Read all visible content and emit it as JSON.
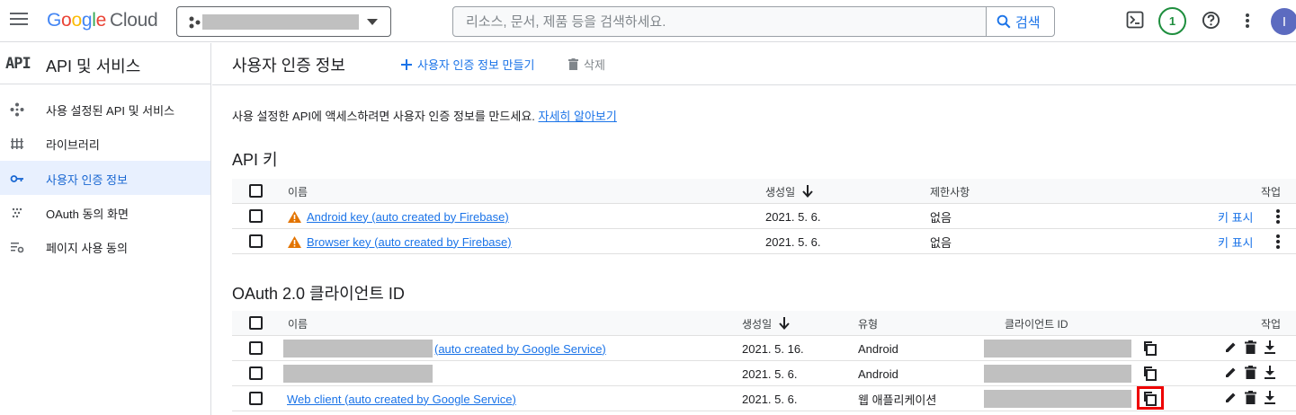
{
  "header": {
    "logo_google": "Google",
    "logo_cloud": "Cloud",
    "search_placeholder": "리소스, 문서, 제품 등을 검색하세요.",
    "search_button": "검색",
    "notification_count": "1",
    "avatar_initial": "I"
  },
  "sidebar": {
    "logo": "API",
    "title": "API 및 서비스",
    "items": [
      {
        "label": "사용 설정된 API 및 서비스",
        "icon": "api-diamond-icon"
      },
      {
        "label": "라이브러리",
        "icon": "library-icon"
      },
      {
        "label": "사용자 인증 정보",
        "icon": "key-icon",
        "active": true
      },
      {
        "label": "OAuth 동의 화면",
        "icon": "oauth-dots-icon"
      },
      {
        "label": "페이지 사용 동의",
        "icon": "settings-list-icon"
      }
    ]
  },
  "main": {
    "title": "사용자 인증 정보",
    "create_label": "사용자 인증 정보 만들기",
    "delete_label": "삭제",
    "intro_text": "사용 설정한 API에 액세스하려면 사용자 인증 정보를 만드세요.",
    "intro_link": "자세히 알아보기"
  },
  "api_keys": {
    "section_title": "API 키",
    "columns": {
      "name": "이름",
      "created": "생성일",
      "restrictions": "제한사항",
      "actions": "작업"
    },
    "rows": [
      {
        "name": "Android key (auto created by Firebase)",
        "created": "2021. 5. 6.",
        "restrictions": "없음",
        "action": "키 표시"
      },
      {
        "name": "Browser key (auto created by Firebase)",
        "created": "2021. 5. 6.",
        "restrictions": "없음",
        "action": "키 표시"
      }
    ]
  },
  "oauth": {
    "section_title": "OAuth 2.0 클라이언트 ID",
    "columns": {
      "name": "이름",
      "created": "생성일",
      "type": "유형",
      "client_id": "클라이언트 ID",
      "actions": "작업"
    },
    "rows": [
      {
        "name": "(auto created by Google Service)",
        "created": "2021. 5. 16.",
        "type": "Android"
      },
      {
        "name": "",
        "created": "2021. 5. 6.",
        "type": "Android"
      },
      {
        "name": "Web client (auto created by Google Service)",
        "created": "2021. 5. 6.",
        "type": "웹 애플리케이션"
      }
    ]
  },
  "colors": {
    "accent": "#1a73e8",
    "active_nav_bg": "#e8f0fe",
    "warning": "#e37400",
    "highlight": "#ee0000"
  }
}
